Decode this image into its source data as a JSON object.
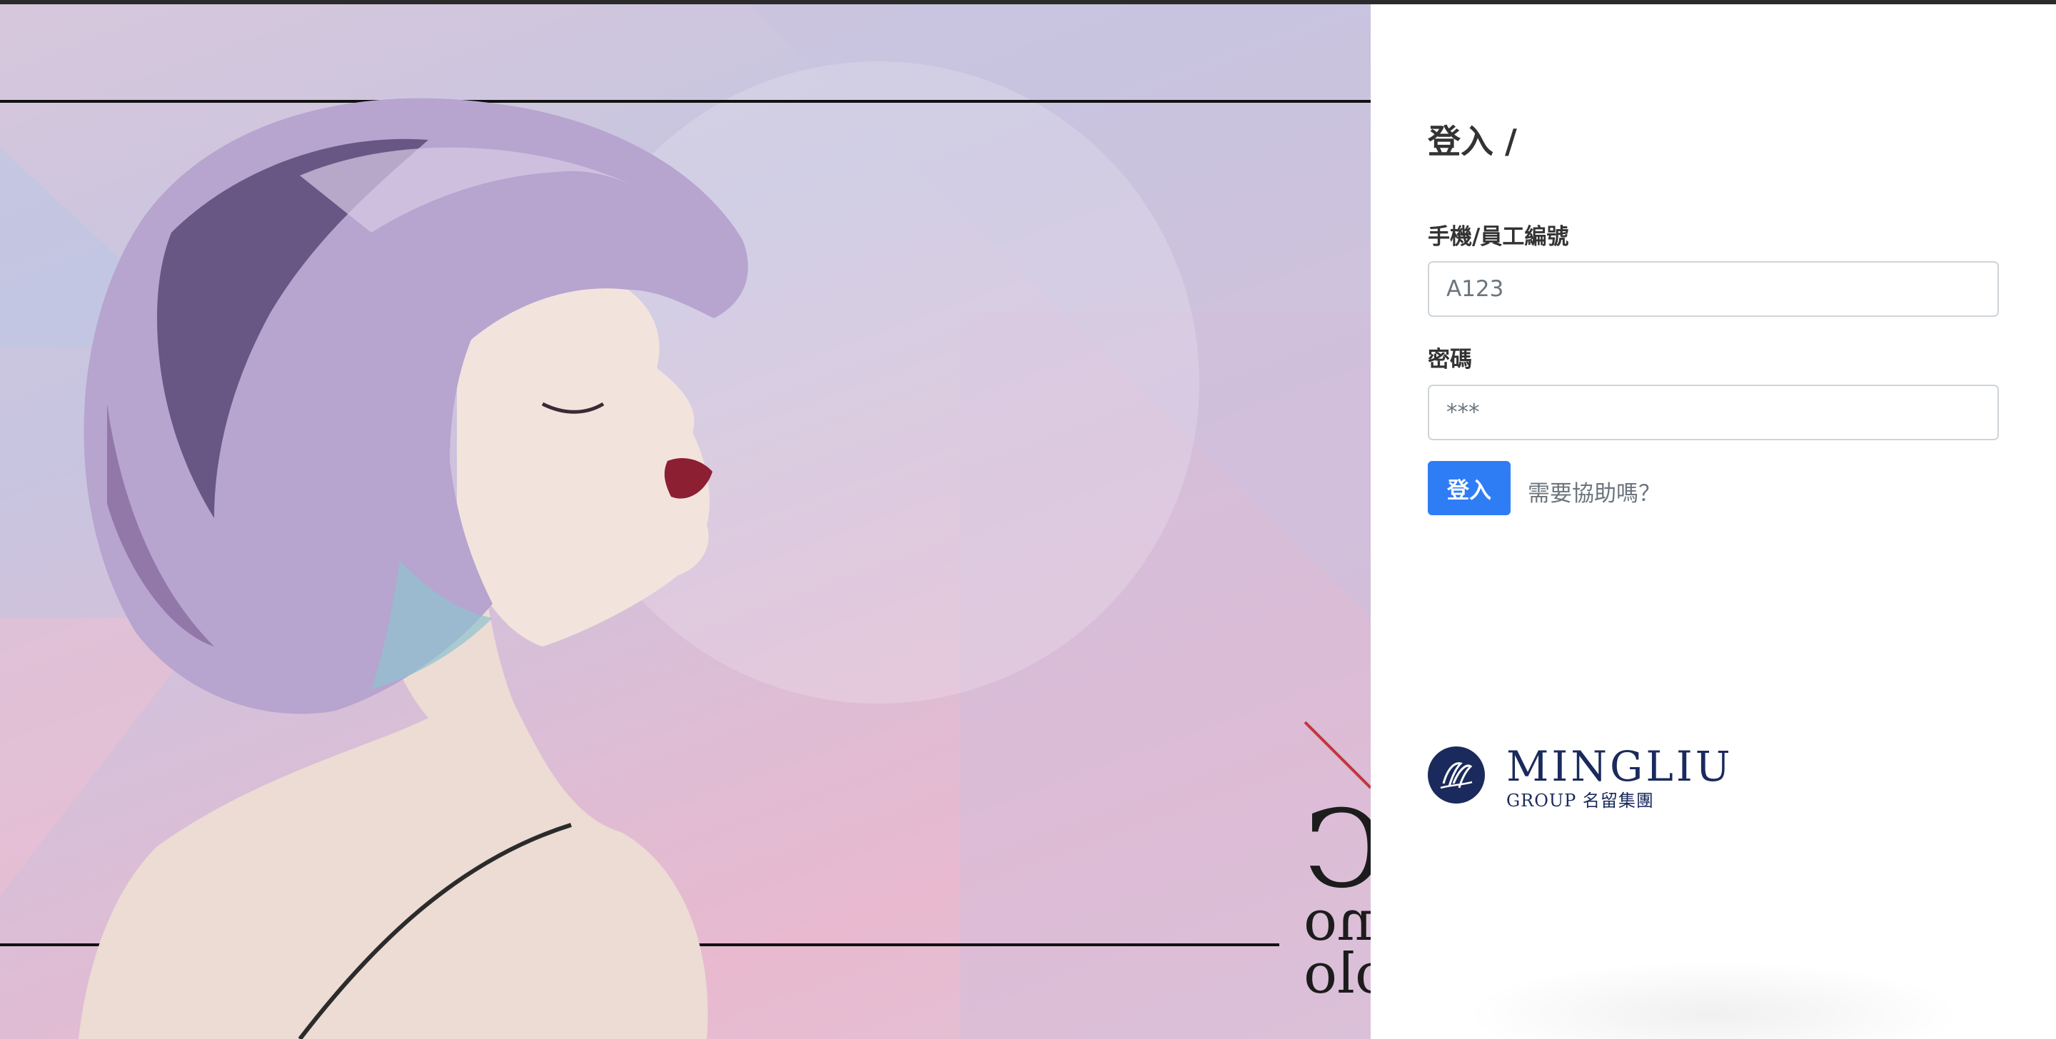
{
  "colors": {
    "accent": "#2f7df5",
    "brand_navy": "#1a2a5c",
    "text_dark": "#333333",
    "text_muted": "#6c757d"
  },
  "hero": {
    "image_subject": "woman with short lavender bob haircut in profile",
    "text_big": "C",
    "text_line1": "lano",
    "text_line2": "rolo"
  },
  "login": {
    "title": "登入 /",
    "account": {
      "label": "手機/員工編號",
      "placeholder": "A123",
      "value": ""
    },
    "password": {
      "label": "密碼",
      "placeholder": "***",
      "value": ""
    },
    "submit_label": "登入",
    "help_label": "需要協助嗎？"
  },
  "logo": {
    "name": "MINGLIU",
    "sub": "GROUP 名留集團",
    "emblem_icon": "mingliu-emblem-icon"
  }
}
